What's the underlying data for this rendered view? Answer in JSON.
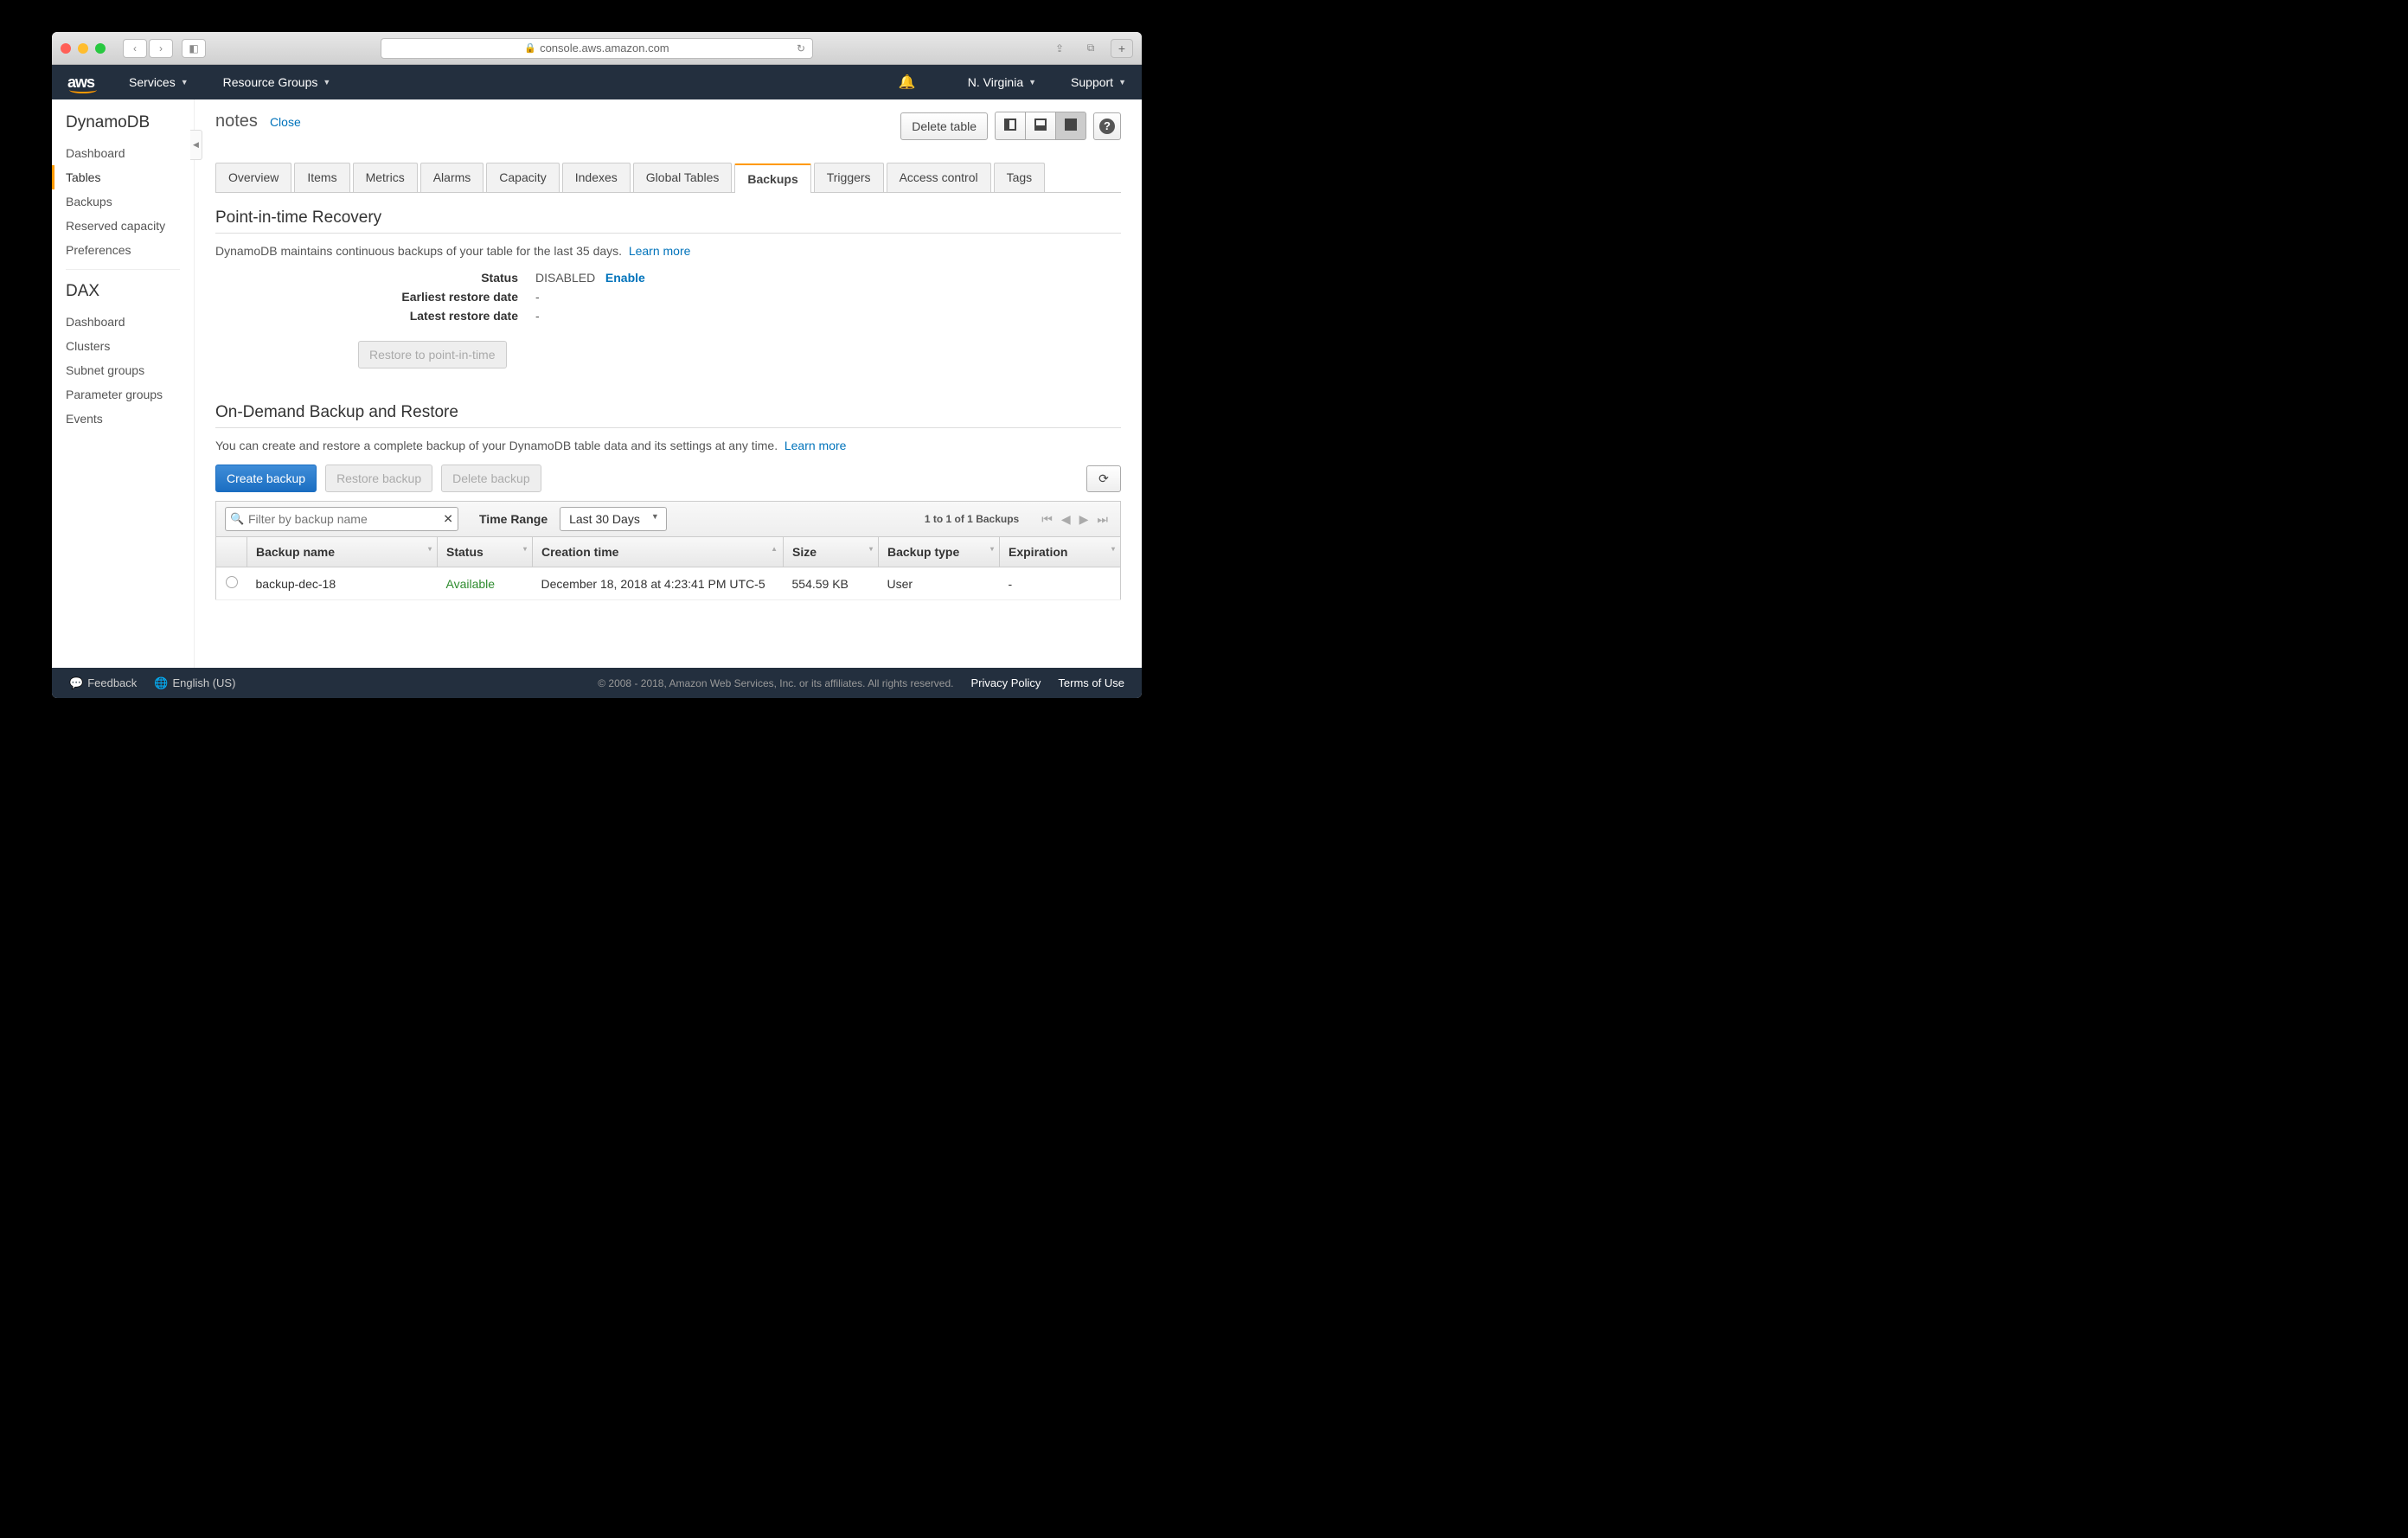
{
  "browser": {
    "address": "console.aws.amazon.com"
  },
  "header": {
    "services": "Services",
    "resource_groups": "Resource Groups",
    "region": "N. Virginia",
    "support": "Support"
  },
  "sidebar": {
    "heading1": "DynamoDB",
    "items1": [
      "Dashboard",
      "Tables",
      "Backups",
      "Reserved capacity",
      "Preferences"
    ],
    "active1": "Tables",
    "heading2": "DAX",
    "items2": [
      "Dashboard",
      "Clusters",
      "Subnet groups",
      "Parameter groups",
      "Events"
    ]
  },
  "page": {
    "title": "notes",
    "close": "Close",
    "delete_table": "Delete table"
  },
  "tabs": [
    "Overview",
    "Items",
    "Metrics",
    "Alarms",
    "Capacity",
    "Indexes",
    "Global Tables",
    "Backups",
    "Triggers",
    "Access control",
    "Tags"
  ],
  "active_tab": "Backups",
  "pitr": {
    "title": "Point-in-time Recovery",
    "desc": "DynamoDB maintains continuous backups of your table for the last 35 days.",
    "learn_more": "Learn more",
    "status_label": "Status",
    "status_value": "DISABLED",
    "enable": "Enable",
    "earliest_label": "Earliest restore date",
    "earliest_value": "-",
    "latest_label": "Latest restore date",
    "latest_value": "-",
    "restore_btn": "Restore to point-in-time"
  },
  "ondemand": {
    "title": "On-Demand Backup and Restore",
    "desc": "You can create and restore a complete backup of your DynamoDB table data and its settings at any time.",
    "learn_more": "Learn more",
    "create_btn": "Create backup",
    "restore_btn": "Restore backup",
    "delete_btn": "Delete backup",
    "filter_placeholder": "Filter by backup name",
    "time_range_label": "Time Range",
    "time_range_value": "Last 30 Days",
    "pager_info": "1 to 1 of 1 Backups",
    "columns": [
      "Backup name",
      "Status",
      "Creation time",
      "Size",
      "Backup type",
      "Expiration"
    ],
    "rows": [
      {
        "name": "backup-dec-18",
        "status": "Available",
        "creation": "December 18, 2018 at 4:23:41 PM UTC-5",
        "size": "554.59 KB",
        "type": "User",
        "expiration": "-"
      }
    ]
  },
  "footer": {
    "feedback": "Feedback",
    "language": "English (US)",
    "copyright": "© 2008 - 2018, Amazon Web Services, Inc. or its affiliates. All rights reserved.",
    "privacy": "Privacy Policy",
    "terms": "Terms of Use"
  }
}
